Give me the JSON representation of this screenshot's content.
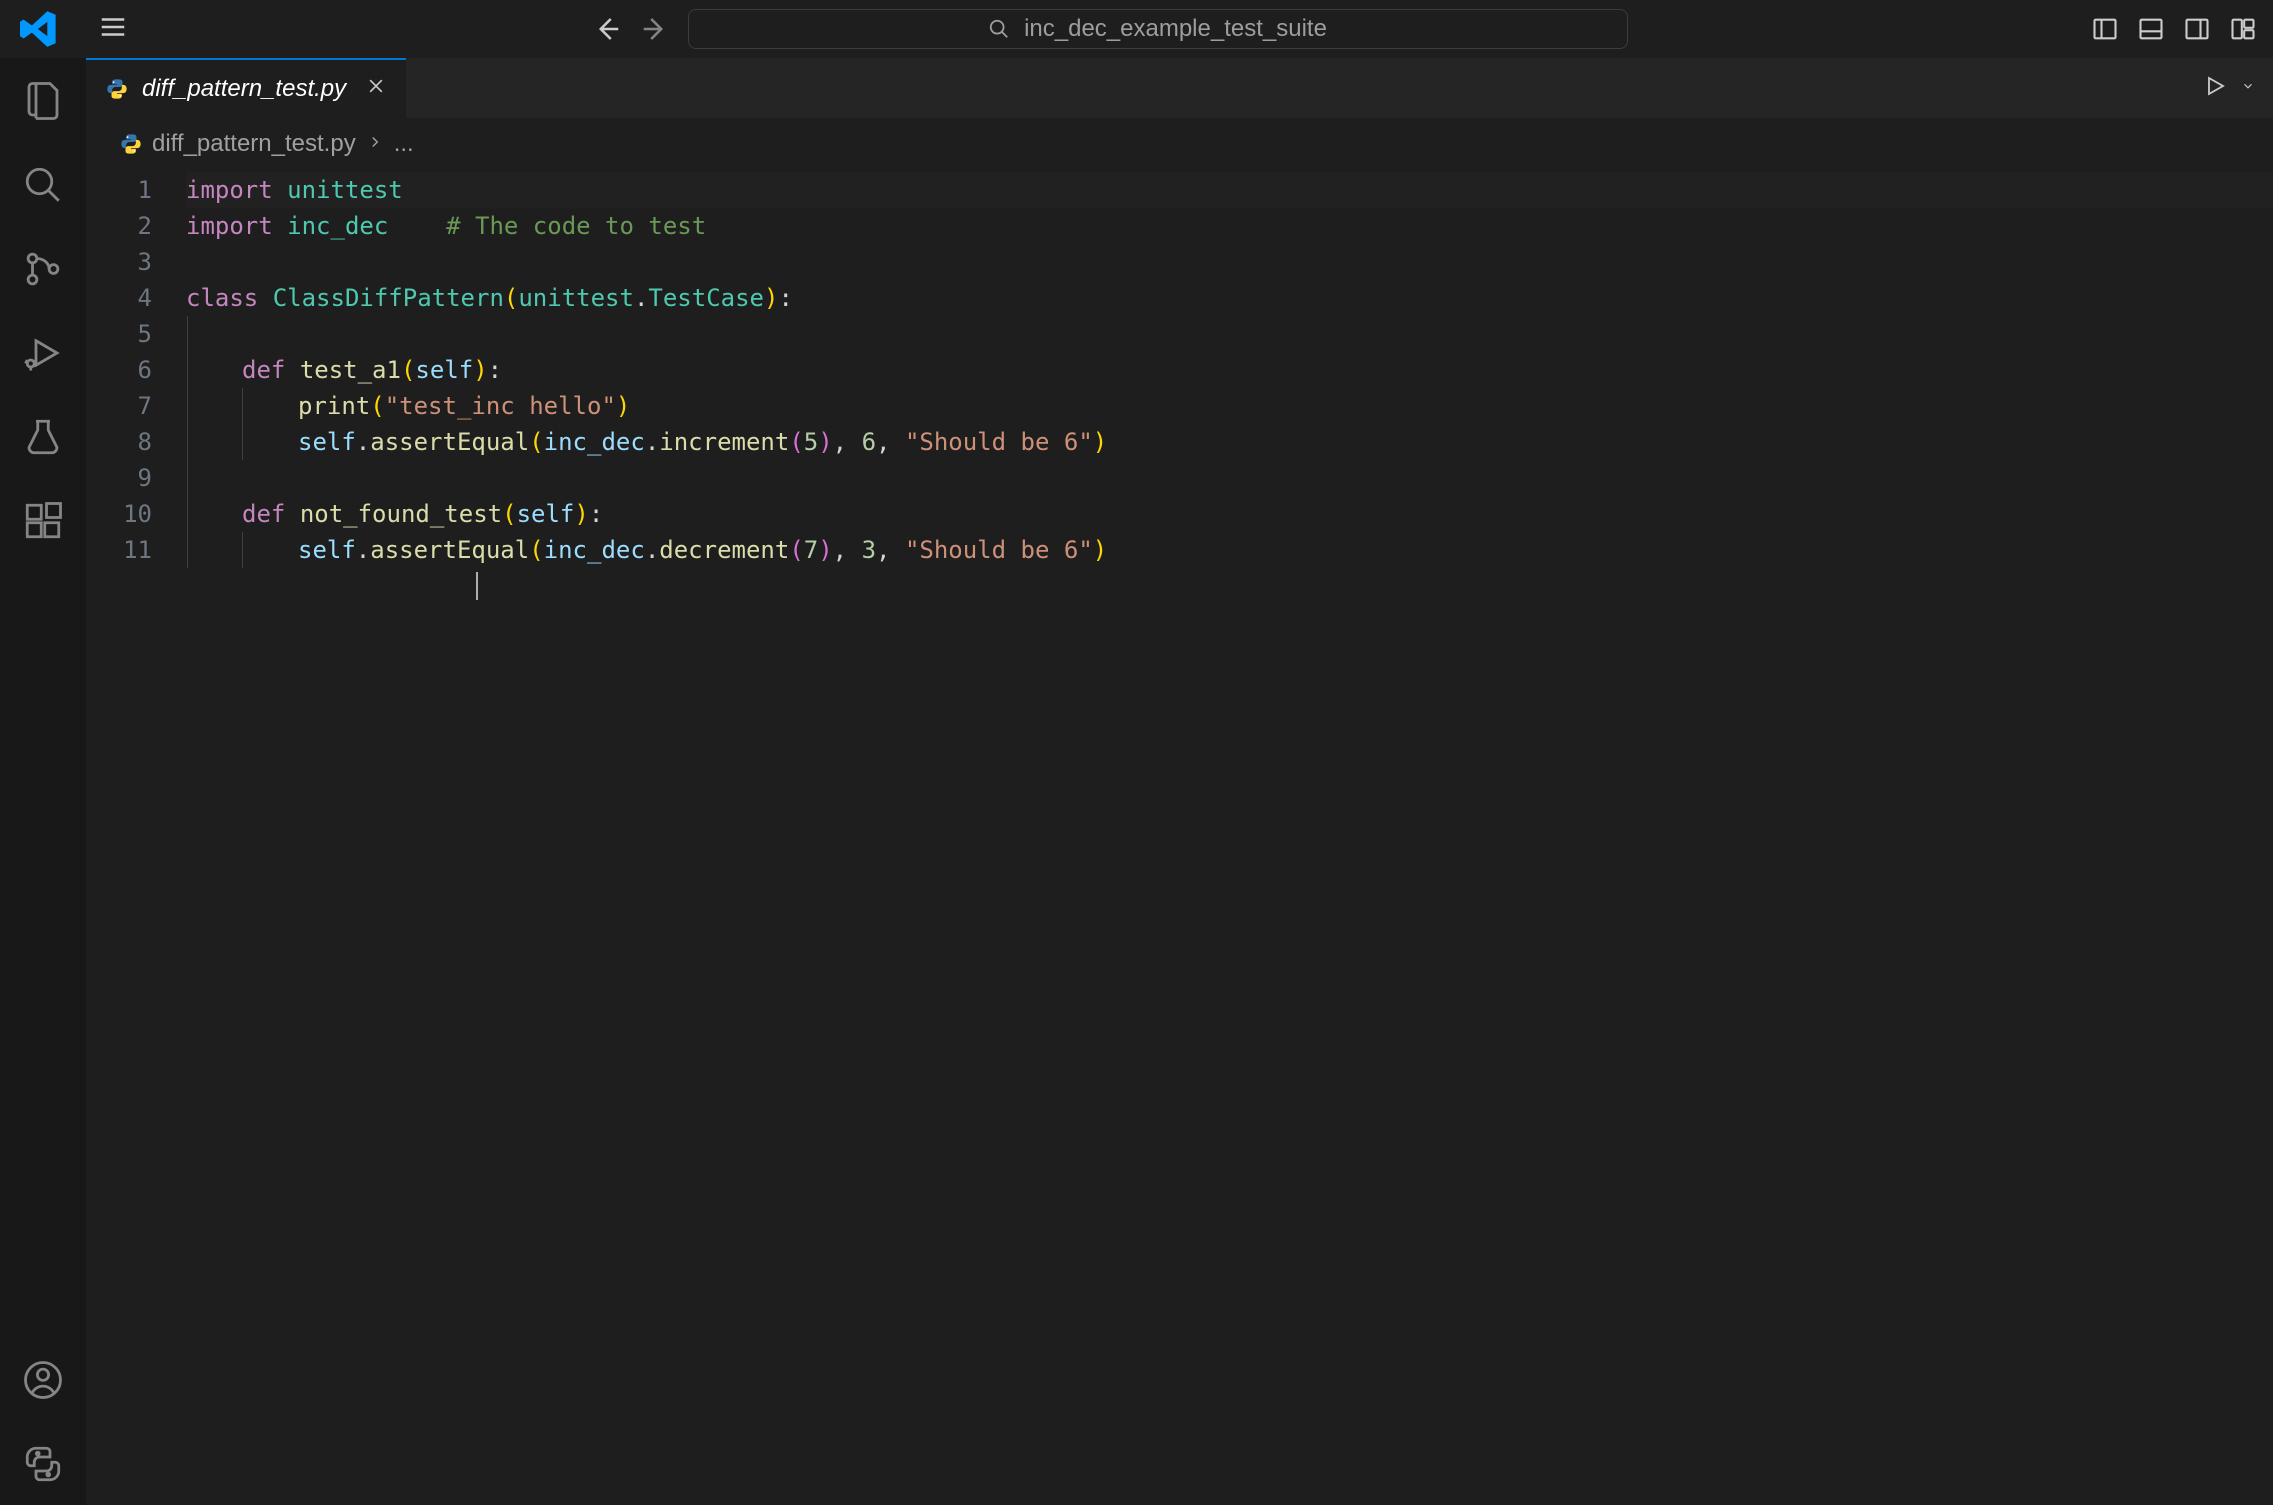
{
  "command_center": {
    "placeholder": "inc_dec_example_test_suite"
  },
  "tab": {
    "filename": "diff_pattern_test.py",
    "icon": "python-file-icon"
  },
  "breadcrumbs": {
    "file": "diff_pattern_test.py",
    "more": "..."
  },
  "editor": {
    "line_numbers": [
      "1",
      "2",
      "3",
      "4",
      "5",
      "6",
      "7",
      "8",
      "9",
      "10",
      "11"
    ],
    "code": {
      "l1_import": "import",
      "l1_mod": "unittest",
      "l2_import": "import",
      "l2_mod": "inc_dec",
      "l2_comment": "# The code to test",
      "l4_class_kw": "class",
      "l4_class_name": "ClassDiffPattern",
      "l4_paren_open": "(",
      "l4_base_mod": "unittest",
      "l4_dot": ".",
      "l4_base_cls": "TestCase",
      "l4_paren_close": ")",
      "l4_colon": ":",
      "l6_def": "def",
      "l6_fn": "test_a1",
      "l6_po": "(",
      "l6_self": "self",
      "l6_pc": ")",
      "l6_colon": ":",
      "l7_print": "print",
      "l7_po": "(",
      "l7_str": "\"test_inc hello\"",
      "l7_pc": ")",
      "l8_self": "self",
      "l8_dot": ".",
      "l8_ae": "assertEqual",
      "l8_po": "(",
      "l8_mod": "inc_dec",
      "l8_dot2": ".",
      "l8_call": "increment",
      "l8_po2": "(",
      "l8_n5": "5",
      "l8_pc2": ")",
      "l8_c1": ", ",
      "l8_n6": "6",
      "l8_c2": ", ",
      "l8_str": "\"Should be 6\"",
      "l8_pc": ")",
      "l10_def": "def",
      "l10_fn": "not_found_test",
      "l10_po": "(",
      "l10_self": "self",
      "l10_pc": ")",
      "l10_colon": ":",
      "l11_self": "self",
      "l11_dot": ".",
      "l11_ae": "assertEqual",
      "l11_po": "(",
      "l11_mod": "inc_dec",
      "l11_dot2": ".",
      "l11_call": "decrement",
      "l11_po2": "(",
      "l11_n7": "7",
      "l11_pc2": ")",
      "l11_c1": ", ",
      "l11_n3": "3",
      "l11_c2": ", ",
      "l11_str": "\"Should be 6\"",
      "l11_pc": ")"
    }
  }
}
